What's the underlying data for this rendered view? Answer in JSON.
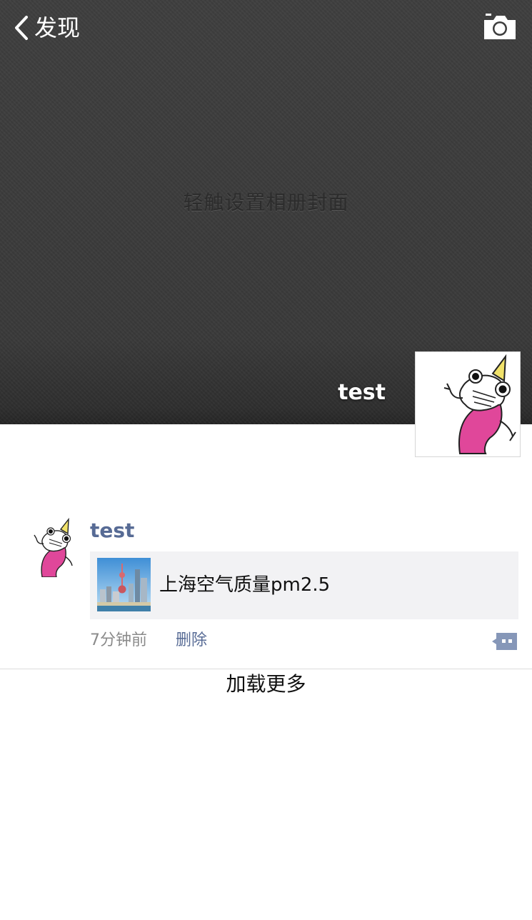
{
  "nav": {
    "back_label": "发现"
  },
  "cover": {
    "hint": "轻触设置相册封面",
    "username": "test"
  },
  "post": {
    "author": "test",
    "link_title": "上海空气质量pm2.5",
    "time": "7分钟前",
    "delete_label": "删除"
  },
  "footer": {
    "load_more_label": "加载更多"
  },
  "icons": {
    "back": "chevron-left-icon",
    "camera": "camera-icon",
    "comment": "comment-icon"
  },
  "colors": {
    "link_blue": "#576b95",
    "cover_gray": "#3d3d3d",
    "card_bg": "#f2f2f4"
  }
}
